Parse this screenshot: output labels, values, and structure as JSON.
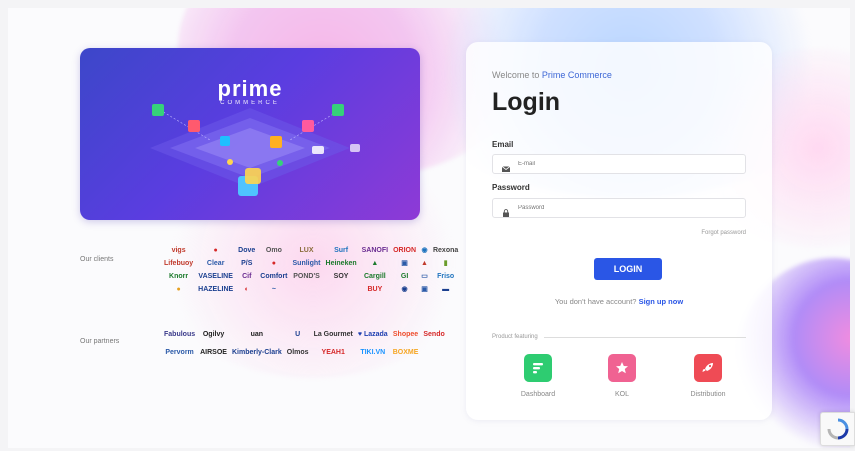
{
  "hero": {
    "logo_text": "prime",
    "logo_subtext": "COMMERCE"
  },
  "clients": {
    "label": "Our clients",
    "logos": [
      {
        "text": "vigs",
        "color": "#c0392b"
      },
      {
        "text": "●",
        "color": "#d62828"
      },
      {
        "text": "Dove",
        "color": "#1b3f8f"
      },
      {
        "text": "Omo",
        "color": "#555"
      },
      {
        "text": "LUX",
        "color": "#8a6d3b"
      },
      {
        "text": "Surf",
        "color": "#1e73be"
      },
      {
        "text": "SANOFI",
        "color": "#6a2c91"
      },
      {
        "text": "ORION",
        "color": "#d62828"
      },
      {
        "text": "◉",
        "color": "#1e73be"
      },
      {
        "text": "Rexona",
        "color": "#444"
      },
      {
        "text": "Lifebuoy",
        "color": "#c0392b"
      },
      {
        "text": "Clear",
        "color": "#2b5aa8"
      },
      {
        "text": "P/S",
        "color": "#1b3f8f"
      },
      {
        "text": "●",
        "color": "#d62828"
      },
      {
        "text": "Sunlight",
        "color": "#2b5aa8"
      },
      {
        "text": "Heineken",
        "color": "#1c7a2c"
      },
      {
        "text": "▲",
        "color": "#1c7a2c"
      },
      {
        "text": "▣",
        "color": "#2b5aa8"
      },
      {
        "text": "▲",
        "color": "#c0392b"
      },
      {
        "text": "▮",
        "color": "#6a9c2b"
      },
      {
        "text": "Knorr",
        "color": "#1c7a2c"
      },
      {
        "text": "VASELINE",
        "color": "#1b3f8f"
      },
      {
        "text": "Cif",
        "color": "#6a2c91"
      },
      {
        "text": "Comfort",
        "color": "#1b3f8f"
      },
      {
        "text": "POND'S",
        "color": "#555"
      },
      {
        "text": "SOY",
        "color": "#333"
      },
      {
        "text": "Cargill",
        "color": "#1c7a2c"
      },
      {
        "text": "GI",
        "color": "#1c7a2c"
      },
      {
        "text": "▭",
        "color": "#2b5aa8"
      },
      {
        "text": "Friso",
        "color": "#1e73be"
      },
      {
        "text": "●",
        "color": "#e6a020"
      },
      {
        "text": "HAZELINE",
        "color": "#1b3f8f"
      },
      {
        "text": "◐",
        "color": "#d62828"
      },
      {
        "text": "~",
        "color": "#2b5aa8"
      },
      {
        "text": "",
        "color": "#999"
      },
      {
        "text": "",
        "color": "#999"
      },
      {
        "text": "BUY",
        "color": "#d62828"
      },
      {
        "text": "◉",
        "color": "#1b3f8f"
      },
      {
        "text": "▣",
        "color": "#2b5aa8"
      },
      {
        "text": "▬",
        "color": "#1b3f8f"
      }
    ]
  },
  "partners": {
    "label": "Our partners",
    "logos": [
      {
        "text": "Fabulous",
        "color": "#3a3a8a"
      },
      {
        "text": "Ogilvy",
        "color": "#222"
      },
      {
        "text": "uan",
        "color": "#222"
      },
      {
        "text": "U",
        "color": "#1b3f8f"
      },
      {
        "text": "La Gourmet",
        "color": "#333"
      },
      {
        "text": "♥ Lazada",
        "color": "#1e3fb0"
      },
      {
        "text": "Shopee",
        "color": "#ee4d2d"
      },
      {
        "text": "Sendo",
        "color": "#d62828"
      },
      {
        "text": "Pervorm",
        "color": "#2b5aa8"
      },
      {
        "text": "AIRSOE",
        "color": "#222"
      },
      {
        "text": "Kimberly-Clark",
        "color": "#1b3f8f"
      },
      {
        "text": "Olmos",
        "color": "#333"
      },
      {
        "text": "YEAH1",
        "color": "#d62828"
      },
      {
        "text": "TIKI.VN",
        "color": "#1a94ff"
      },
      {
        "text": "BOXME",
        "color": "#f5a623"
      }
    ]
  },
  "login": {
    "welcome_prefix": "Welcome to ",
    "brand": "Prime Commerce",
    "title": "Login",
    "email_label": "Email",
    "email_placeholder": "E-mail",
    "password_label": "Password",
    "password_placeholder": "Password",
    "forgot": "Forgot password",
    "button": "LOGIN",
    "no_account": "You don't have account?",
    "signup": "Sign up now"
  },
  "features": {
    "title": "Product featuring",
    "items": [
      {
        "label": "Dashboard",
        "color": "#2ecc71",
        "icon": "dashboard-icon"
      },
      {
        "label": "KOL",
        "color": "#f06292",
        "icon": "star-icon"
      },
      {
        "label": "Distribution",
        "color": "#ef4b55",
        "icon": "rocket-icon"
      }
    ]
  },
  "colors": {
    "accent": "#2a56e6",
    "brand_link": "#3d67d6"
  }
}
